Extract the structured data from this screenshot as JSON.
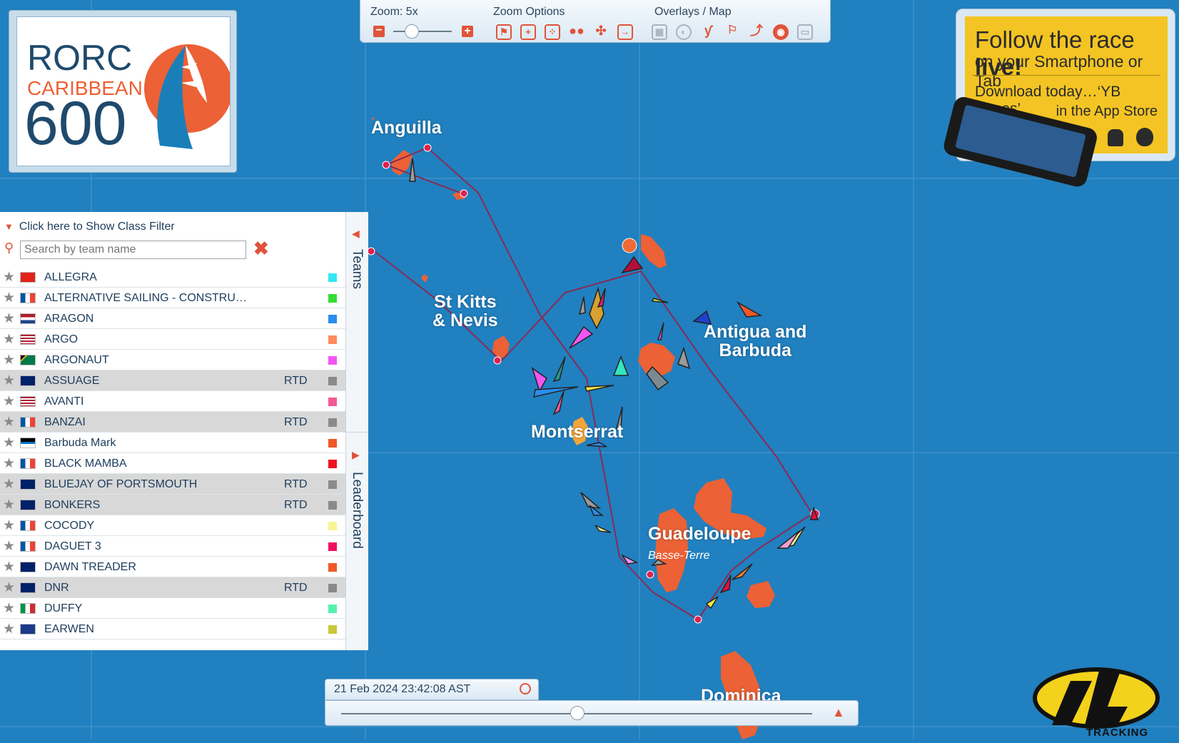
{
  "logo": {
    "line1": "RORC",
    "line2": "CARIBBEAN",
    "line3": "600"
  },
  "toolbar": {
    "zoom_label": "Zoom: 5x",
    "zoom_level": 5,
    "zoom_options_label": "Zoom Options",
    "overlays_label": "Overlays / Map",
    "zoom_options_icons": [
      "flag-icon",
      "zoom-in-box-icon",
      "dots-icon",
      "group-icon",
      "fit-icon",
      "exit-icon"
    ],
    "overlay_icons": [
      "grid-icon",
      "contrast-icon",
      "branch-icon",
      "windsock-icon",
      "route-icon",
      "globe-icon",
      "panel-icon"
    ]
  },
  "ad": {
    "line1_a": "Follow the race ",
    "line1_b": "live!",
    "line2": "on your Smartphone or Tab",
    "line3": "Download today…‘YB Races’",
    "line4": "in the App Store"
  },
  "map": {
    "islands": [
      {
        "name": "Anguilla"
      },
      {
        "name": "St Kitts\n& Nevis"
      },
      {
        "name": "Antigua and\nBarbuda"
      },
      {
        "name": "Montserrat"
      },
      {
        "name": "Guadeloupe"
      },
      {
        "name": "Dominica"
      }
    ],
    "towns": [
      "Basse-Terre"
    ]
  },
  "panel": {
    "filter_label": "Click here to Show Class Filter",
    "search_placeholder": "Search by team name",
    "tabs": {
      "teams": "Teams",
      "leaderboard": "Leaderboard"
    },
    "teams": [
      {
        "name": "ALLEGRA",
        "flag": "CH",
        "status": "",
        "color": "#33e6f2"
      },
      {
        "name": "ALTERNATIVE SAILING - CONSTRU…",
        "flag": "FR",
        "status": "",
        "color": "#33dd33"
      },
      {
        "name": "ARAGON",
        "flag": "NL",
        "status": "",
        "color": "#2a8df0"
      },
      {
        "name": "ARGO",
        "flag": "US",
        "status": "",
        "color": "#ff8a5c"
      },
      {
        "name": "ARGONAUT",
        "flag": "ZA",
        "status": "",
        "color": "#f455f2"
      },
      {
        "name": "ASSUAGE",
        "flag": "GB",
        "status": "RTD",
        "color": "#8a8a8a"
      },
      {
        "name": "AVANTI",
        "flag": "US",
        "status": "",
        "color": "#f25a96"
      },
      {
        "name": "BANZAI",
        "flag": "FR",
        "status": "RTD",
        "color": "#8a8a8a"
      },
      {
        "name": "Barbuda Mark",
        "flag": "AG",
        "status": "",
        "color": "#f0582a"
      },
      {
        "name": "BLACK MAMBA",
        "flag": "FR",
        "status": "",
        "color": "#f01020"
      },
      {
        "name": "BLUEJAY OF PORTSMOUTH",
        "flag": "GB",
        "status": "RTD",
        "color": "#8a8a8a"
      },
      {
        "name": "BONKERS",
        "flag": "GB",
        "status": "RTD",
        "color": "#8a8a8a"
      },
      {
        "name": "COCODY",
        "flag": "FR",
        "status": "",
        "color": "#f8f590"
      },
      {
        "name": "DAGUET 3",
        "flag": "FR",
        "status": "",
        "color": "#f01060"
      },
      {
        "name": "DAWN TREADER",
        "flag": "GB",
        "status": "",
        "color": "#f0582a"
      },
      {
        "name": "DNR",
        "flag": "GB",
        "status": "RTD",
        "color": "#8a8a8a"
      },
      {
        "name": "DUFFY",
        "flag": "IT",
        "status": "",
        "color": "#55f0b0"
      },
      {
        "name": "EARWEN",
        "flag": "XX",
        "status": "",
        "color": "#c8c838"
      }
    ]
  },
  "timeline": {
    "datetime": "21 Feb 2024 23:42:08 AST",
    "position_fraction": 0.5
  },
  "brand": {
    "tracking_label": "TRACKING"
  }
}
